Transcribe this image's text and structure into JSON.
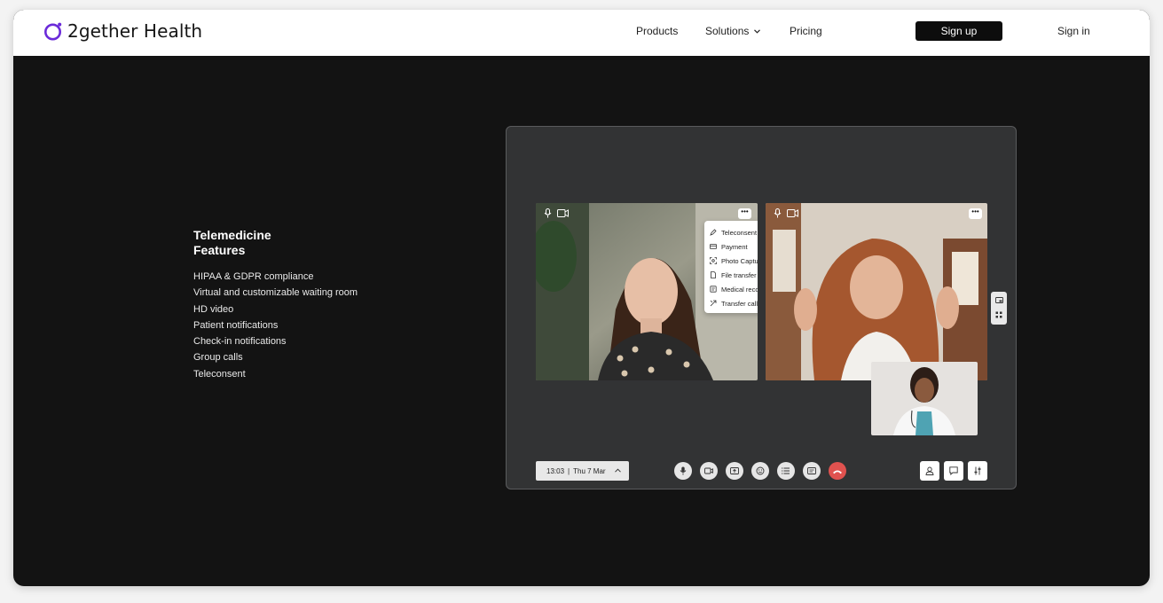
{
  "header": {
    "logo_text": "2gether Health",
    "nav": {
      "products": "Products",
      "solutions": "Solutions",
      "pricing": "Pricing"
    },
    "signup_label": "Sign up",
    "signin_label": "Sign in"
  },
  "features": {
    "title": "Telemedicine Features",
    "items": [
      "HIPAA & GDPR compliance",
      "Virtual and customizable waiting room",
      "HD video",
      "Patient notifications",
      "Check-in notifications",
      "Group calls",
      "Teleconsent"
    ]
  },
  "call": {
    "more_label": "•••",
    "menu": [
      {
        "label": "Teleconsent",
        "icon": "pen-icon"
      },
      {
        "label": "Payment",
        "icon": "card-icon"
      },
      {
        "label": "Photo Capture",
        "icon": "capture-icon"
      },
      {
        "label": "File transfer",
        "icon": "file-icon"
      },
      {
        "label": "Medical record",
        "icon": "record-icon"
      },
      {
        "label": "Transfer call",
        "icon": "transfer-icon"
      }
    ],
    "time": "13:03",
    "date": "Thu 7 Mar",
    "separator": "|"
  },
  "colors": {
    "brand": "#6b2bd9",
    "end_call": "#e0524f",
    "background": "#131313"
  }
}
